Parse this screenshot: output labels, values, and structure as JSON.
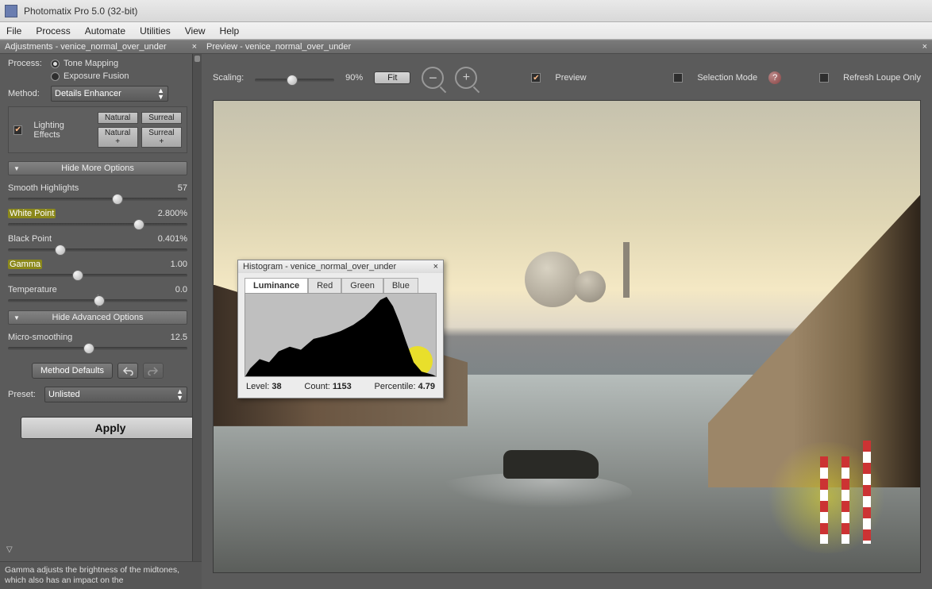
{
  "window_title": "Photomatix Pro 5.0 (32-bit)",
  "menu": [
    "File",
    "Process",
    "Automate",
    "Utilities",
    "View",
    "Help"
  ],
  "adjustments": {
    "panel_title": "Adjustments - venice_normal_over_under",
    "process_label": "Process:",
    "tone_mapping": "Tone Mapping",
    "exposure_fusion": "Exposure Fusion",
    "method_label": "Method:",
    "method_value": "Details Enhancer",
    "lighting_effects_label": "Lighting Effects",
    "lighting_buttons": {
      "natural": "Natural",
      "surreal": "Surreal",
      "natural_plus": "Natural +",
      "surreal_plus": "Surreal +"
    },
    "hide_more": "Hide More Options",
    "sliders": {
      "smooth_highlights": {
        "label": "Smooth Highlights",
        "value": "57",
        "pos": 58
      },
      "white_point": {
        "label": "White Point",
        "value": "2.800%",
        "pos": 70,
        "hl": true
      },
      "black_point": {
        "label": "Black Point",
        "value": "0.401%",
        "pos": 26
      },
      "gamma": {
        "label": "Gamma",
        "value": "1.00",
        "pos": 36,
        "hl": true
      },
      "temperature": {
        "label": "Temperature",
        "value": "0.0",
        "pos": 50,
        "tick": true
      }
    },
    "hide_advanced": "Hide Advanced Options",
    "micro": {
      "label": "Micro-smoothing",
      "value": "12.5",
      "pos": 42
    },
    "method_defaults": "Method Defaults",
    "preset_label": "Preset:",
    "preset_value": "Unlisted",
    "apply": "Apply",
    "help": "Gamma adjusts the brightness of the midtones, which also has an impact on the"
  },
  "preview": {
    "panel_title": "Preview - venice_normal_over_under",
    "scaling_label": "Scaling:",
    "scaling_value": "90%",
    "fit": "Fit",
    "preview_chk": "Preview",
    "selection_mode": "Selection Mode",
    "refresh_loupe": "Refresh Loupe Only"
  },
  "histogram": {
    "title": "Histogram - venice_normal_over_under",
    "tabs": {
      "lum": "Luminance",
      "red": "Red",
      "green": "Green",
      "blue": "Blue"
    },
    "level_lbl": "Level:",
    "level": "38",
    "count_lbl": "Count:",
    "count": "1153",
    "pct_lbl": "Percentile:",
    "pct": "4.79"
  }
}
